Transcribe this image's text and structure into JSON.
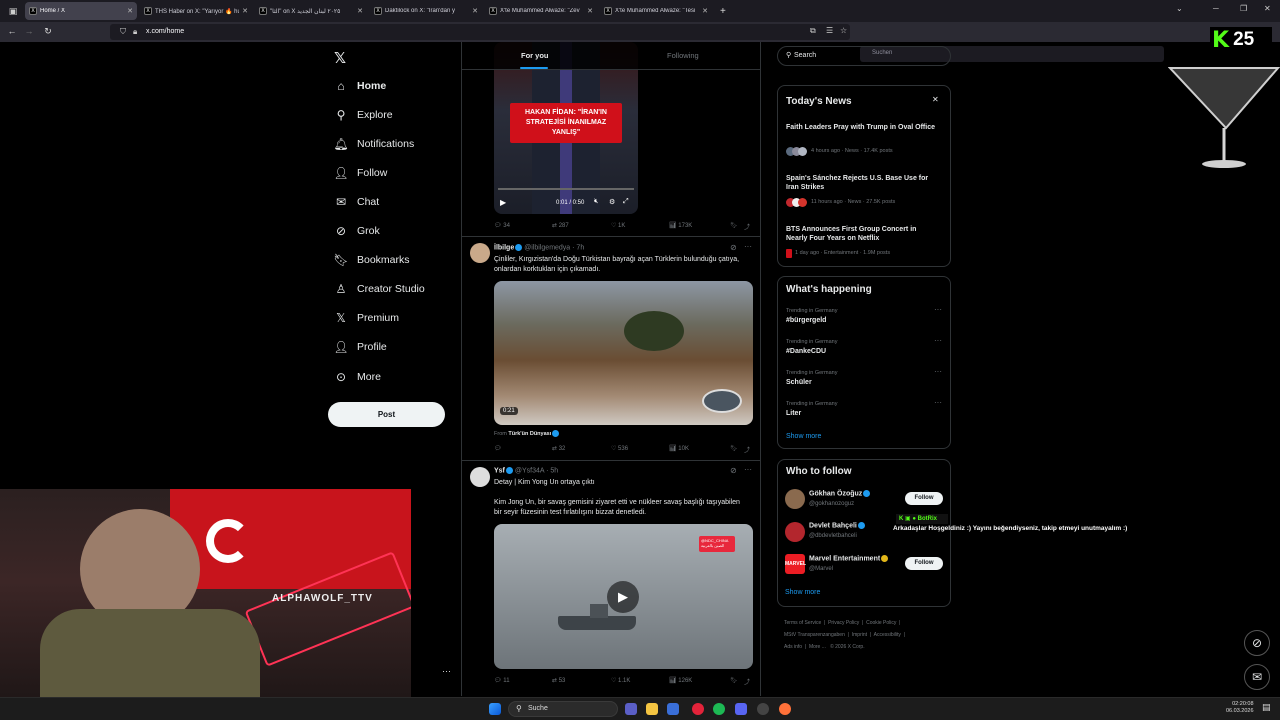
{
  "browser": {
    "tabs": [
      {
        "title": "Home / X",
        "active": true
      },
      {
        "title": "THS Haber on X: \"Yarıyor 🔥 hu"
      },
      {
        "title": "\"الثا\" on X ٢٠٢٥ لبنان الجديد"
      },
      {
        "title": "Daktilock on X: \"İran'dan y"
      },
      {
        "title": "X'te Muhammed Alwaze: \"Zev"
      },
      {
        "title": "X'te Muhammed Alwaze: \"Tesi"
      }
    ],
    "new_tab": "+",
    "url": "x.com/home",
    "search_placeholder": "Suchen"
  },
  "nav": {
    "items": [
      {
        "label": "Home",
        "icon": "home-icon"
      },
      {
        "label": "Explore",
        "icon": "search-icon"
      },
      {
        "label": "Notifications",
        "icon": "bell-icon"
      },
      {
        "label": "Follow",
        "icon": "person-plus-icon"
      },
      {
        "label": "Chat",
        "icon": "mail-icon"
      },
      {
        "label": "Grok",
        "icon": "grok-icon"
      },
      {
        "label": "Bookmarks",
        "icon": "bookmark-icon"
      },
      {
        "label": "Creator Studio",
        "icon": "creator-icon"
      },
      {
        "label": "Premium",
        "icon": "x-icon"
      },
      {
        "label": "Profile",
        "icon": "person-icon"
      },
      {
        "label": "More",
        "icon": "more-circle-icon"
      }
    ],
    "post_label": "Post"
  },
  "feed": {
    "tabs": [
      "For you",
      "Following"
    ],
    "video1": {
      "caption": "HAKAN FİDAN: \"İRAN'IN STRATEJİSİ İNANILMAZ YANLIŞ\"",
      "time": "0:01 / 0:50",
      "actions": {
        "reply": "34",
        "repost": "287",
        "like": "1K",
        "views": "173K"
      }
    },
    "tweet2": {
      "name": "İlbilge",
      "handle": "@ilbilgemedya · 7h",
      "text": "Çinliler, Kırgızistan'da Doğu Türkistan bayrağı açan Türklerin bulunduğu çatıya, onlardan korktukları için çıkamadı.",
      "duration": "0:21",
      "from_label": "From",
      "from_source": "Türk'ün Dünyası",
      "actions": {
        "reply": "",
        "repost": "32",
        "like": "536",
        "views": "10K"
      }
    },
    "tweet3": {
      "name": "Ysf",
      "handle": "@Ysf34A · 5h",
      "line1": "Detay | Kim Yong Un ortaya çıktı",
      "line2": "Kim Jong Un, bir savaş gemisini ziyaret etti ve nükleer savaş başlığı taşıyabilen bir seyir füzesinin test fırlatılışını bizzat denetledi.",
      "badge": "@NDC_CHINA الصين بالعربية",
      "actions": {
        "reply": "11",
        "repost": "53",
        "like": "1.1K",
        "views": "126K"
      }
    }
  },
  "right": {
    "search_placeholder": "Search",
    "news_title": "Today's News",
    "news": [
      {
        "title": "Faith Leaders Pray with Trump in Oval Office",
        "meta": "4 hours ago · News · 17.4K posts"
      },
      {
        "title": "Spain's Sánchez Rejects U.S. Base Use for Iran Strikes",
        "meta": "11 hours ago · News · 27.5K posts"
      },
      {
        "title": "BTS Announces First Group Concert in Nearly Four Years on Netflix",
        "meta": "1 day ago · Entertainment · 1.9M posts"
      }
    ],
    "happening_title": "What's happening",
    "trends": [
      {
        "context": "Trending in Germany",
        "name": "#bürgergeld"
      },
      {
        "context": "Trending in Germany",
        "name": "#DankeCDU"
      },
      {
        "context": "Trending in Germany",
        "name": "Schüler"
      },
      {
        "context": "Trending in Germany",
        "name": "Liter"
      }
    ],
    "show_more": "Show more",
    "wtf_title": "Who to follow",
    "follow": [
      {
        "name": "Gökhan Özoğuz",
        "handle": "@gokhanozoguz"
      },
      {
        "name": "Devlet Bahçeli",
        "handle": "@dbdevletbahceli"
      },
      {
        "name": "Marvel Entertainment",
        "handle": "@Marvel"
      }
    ],
    "follow_label": "Follow",
    "footer": [
      "Terms of Service",
      "Privacy Policy",
      "Cookie Policy",
      "MStV Transparenzangaben",
      "Imprint",
      "Accessibility",
      "Ads info",
      "More ...",
      "© 2026 X Corp."
    ]
  },
  "overlay": {
    "kick_count": "25",
    "streamer_name": "ALPHAWOLF_TTV",
    "bot_name": "BotRix",
    "bot_message": "Arkadaşlar Hoşgeldiniz :) Yayını beğendiyseniz, takip etmeyi unutmayalım :)"
  },
  "taskbar": {
    "search": "Suche",
    "time": "02:20:08",
    "date": "06.03.2026"
  }
}
